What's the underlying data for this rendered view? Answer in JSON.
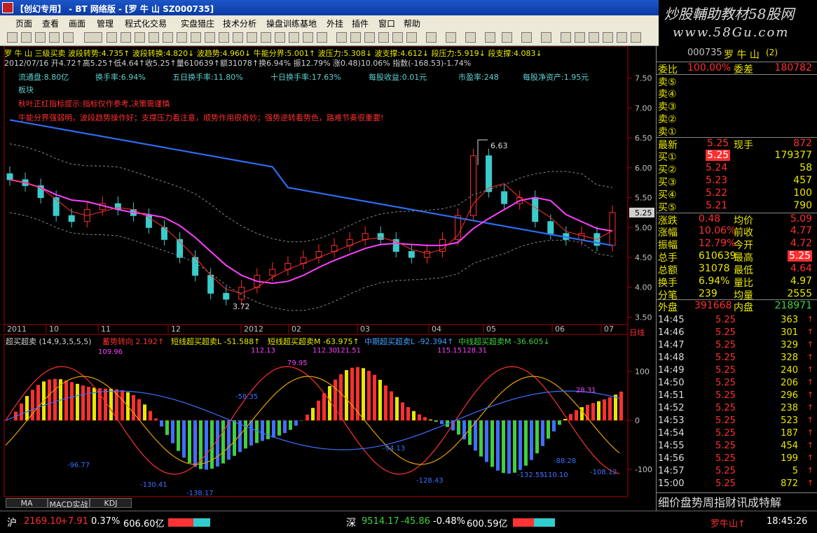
{
  "window": {
    "title": "【创幻专用】 - BT 网络版 - [罗 牛 山 SZ000735]"
  },
  "watermark": {
    "line1": "炒股輔助教材58股网",
    "line2": "www.58Gu.com"
  },
  "menu": [
    "页面",
    "查看",
    "画面",
    "管理",
    "程式化交易",
    "实盘猎庄",
    "技术分析",
    "操盘训练基地",
    "外挂",
    "插件",
    "窗口",
    "帮助"
  ],
  "header": {
    "row1": "罗 牛 山  三级买卖  波段转势:4.735↑ 波段转换:4.820↓ 波趋势:4.960↓ 牛能分界:5.001↑ 波压力:5.308↓ 波支撑:4.612↓ 段压力:5.919↓ 段支撑:4.083↓",
    "row2": "2012/07/16 开4.72↑高5.25↑低4.64↑收5.25↑量610639↑额31078↑换6.94% 振12.79% 涨0.48)10.06% 指数(-168.53)-1.74%",
    "info": [
      "流通盘:8.80亿",
      "换手率:6.94%",
      "五日换手率:11.80%",
      "十日换手率:17.63%",
      "每股收益:0.01元",
      "市盈率:248",
      "每股净资产:1.95元"
    ],
    "block": "板块",
    "tip1": "秋叶正红指标提示:指标仅作参考,决策需谨慎",
    "tip2": "牛能分界强弱明，波段趋势操作好；支撑压力看注意，顺势作用很奇妙；强势逆转看势色，路难节奏很重要!"
  },
  "price_axis": [
    "7.50",
    "7.00",
    "6.50",
    "6.00",
    "5.50",
    "5.00",
    "4.50",
    "4.00",
    "3.50"
  ],
  "current_price_tag": "5.25",
  "annot": {
    "high": "6.63",
    "low": "3.72"
  },
  "time_axis": [
    "2011",
    "10",
    "11",
    "12",
    "2012",
    "02",
    "03",
    "04",
    "05",
    "06",
    "07"
  ],
  "period": "日线",
  "indicator": {
    "name": "超买超卖 (14,9,3,5,5,5)",
    "legend": [
      "蓄势转向 2.192↑",
      "短线超买超卖L -51.588↑",
      "短线超买超卖M -63.975↑",
      "中期超买超卖L -92.394↑",
      "中线超买超卖M -36.605↓"
    ],
    "labels": [
      "109.96",
      "112.13",
      "79.95",
      "112.30",
      "121.51",
      "115.15",
      "128.31",
      "28.31",
      "-96.77",
      "-130.41",
      "-138.17",
      "-94.13",
      "-128.43",
      "-132.55",
      "-110.10",
      "-88.28",
      "-108.12",
      "-58.35"
    ],
    "axis": [
      "100",
      "0",
      "-100"
    ]
  },
  "bottom_tabs": [
    "MA",
    "MACD实战",
    "KDJ"
  ],
  "quote": {
    "code": "000735",
    "name": "罗 牛 山",
    "tag": "(2)",
    "wei": [
      {
        "label": "委比",
        "value": "100.00%"
      },
      {
        "label": "委差",
        "value": "180782"
      }
    ],
    "sells": [
      {
        "label": "卖⑤",
        "price": "",
        "vol": ""
      },
      {
        "label": "卖④",
        "price": "",
        "vol": ""
      },
      {
        "label": "卖③",
        "price": "",
        "vol": ""
      },
      {
        "label": "卖②",
        "price": "",
        "vol": ""
      },
      {
        "label": "卖①",
        "price": "",
        "vol": ""
      }
    ],
    "last": {
      "label": "最新",
      "price": "5.25",
      "l2": "现手",
      "v2": "872"
    },
    "buys": [
      {
        "label": "买①",
        "price": "5.25",
        "vol": "179377"
      },
      {
        "label": "买②",
        "price": "5.24",
        "vol": "58"
      },
      {
        "label": "买③",
        "price": "5.23",
        "vol": "457"
      },
      {
        "label": "买④",
        "price": "5.22",
        "vol": "100"
      },
      {
        "label": "买⑤",
        "price": "5.21",
        "vol": "790"
      }
    ],
    "stats": [
      {
        "l1": "涨跌",
        "v1": "0.48",
        "l2": "均价",
        "v2": "5.09"
      },
      {
        "l1": "涨幅",
        "v1": "10.06%",
        "l2": "前收",
        "v2": "4.77"
      },
      {
        "l1": "振幅",
        "v1": "12.79%",
        "l2": "今开",
        "v2": "4.72"
      },
      {
        "l1": "总手",
        "v1": "610639",
        "l2": "最高",
        "v2": "5.25"
      },
      {
        "l1": "总额",
        "v1": "31078",
        "l2": "最低",
        "v2": "4.64"
      },
      {
        "l1": "换手",
        "v1": "6.94%",
        "l2": "量比",
        "v2": "4.97"
      },
      {
        "l1": "分笔",
        "v1": "239",
        "l2": "均量",
        "v2": "2555"
      }
    ],
    "outer": {
      "l1": "外盘",
      "v1": "391668",
      "l2": "内盘",
      "v2": "218971"
    },
    "ticks": [
      [
        "14:45",
        "5.25",
        "363"
      ],
      [
        "14:46",
        "5.25",
        "301"
      ],
      [
        "14:47",
        "5.25",
        "329"
      ],
      [
        "14:48",
        "5.25",
        "328"
      ],
      [
        "14:49",
        "5.25",
        "240"
      ],
      [
        "14:50",
        "5.25",
        "206"
      ],
      [
        "14:51",
        "5.25",
        "296"
      ],
      [
        "14:52",
        "5.25",
        "238"
      ],
      [
        "14:53",
        "5.25",
        "523"
      ],
      [
        "14:54",
        "5.25",
        "187"
      ],
      [
        "14:55",
        "5.25",
        "454"
      ],
      [
        "14:56",
        "5.25",
        "199"
      ],
      [
        "14:57",
        "5.25",
        "5"
      ],
      [
        "15:00",
        "5.25",
        "872"
      ]
    ],
    "tabs": "细价盘势周指财讯成特解"
  },
  "status": {
    "sh": {
      "label": "沪",
      "val": "2169.10",
      "chg": "+7.91",
      "pct": "0.37%",
      "amt": "606.60亿"
    },
    "sz": {
      "label": "深",
      "val": "9514.17",
      "chg": "-45.86",
      "pct": "-0.48%",
      "amt": "600.59亿"
    },
    "stock": "罗牛山↑",
    "time": "18:45:26"
  },
  "chart_data": {
    "type": "candlestick",
    "title": "罗 牛 山",
    "price_range": [
      3.4,
      7.8
    ],
    "highs": {
      "max": 6.63,
      "min": 3.72
    },
    "close": [
      5.8,
      5.7,
      5.5,
      5.2,
      5.1,
      5.3,
      5.4,
      5.3,
      5.2,
      5.0,
      4.8,
      4.5,
      4.2,
      3.9,
      3.8,
      4.0,
      4.2,
      4.3,
      4.4,
      4.5,
      4.6,
      4.7,
      4.8,
      4.9,
      4.8,
      4.6,
      4.5,
      4.6,
      4.8,
      5.2,
      6.2,
      5.6,
      5.4,
      5.5,
      5.1,
      4.9,
      4.8,
      4.9,
      4.7,
      5.25
    ]
  }
}
